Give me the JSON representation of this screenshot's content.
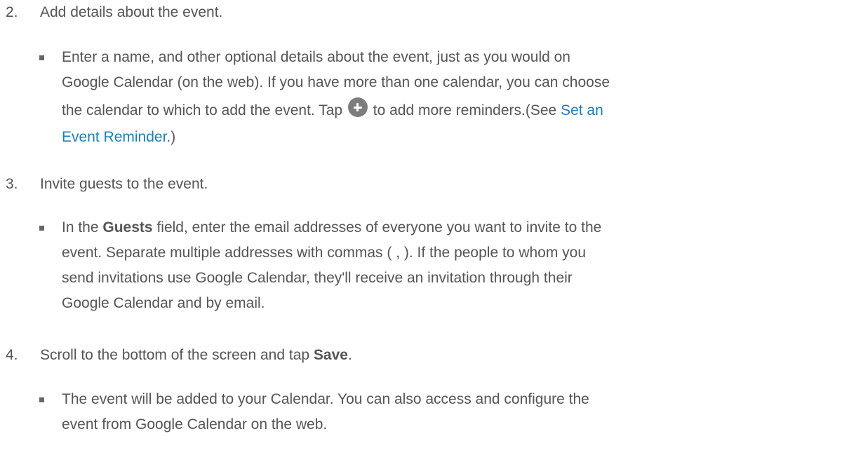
{
  "steps": [
    {
      "number": "2.",
      "text": "Add details about the event.",
      "bullet": {
        "line1": "Enter a name, and other optional details about the event, just as you would on",
        "line2": "Google Calendar (on the web). If you have more than one calendar, you can choose",
        "line3_before_icon": "the calendar to which to add the event. Tap",
        "icon": "plus-circle-icon",
        "line3_after_icon": "to add more reminders.(See",
        "link_part1": "Set an",
        "link_part2": "Event Reminder",
        "line4_after_link": ".)"
      }
    },
    {
      "number": "3.",
      "text": "Invite guests to the event.",
      "bullet": {
        "line1_before_bold": "In the",
        "line1_bold": "Guests",
        "line1_after_bold": "field, enter the email addresses of everyone you want to invite to the",
        "line2": "event. Separate multiple addresses with commas ( , ). If the people to whom you",
        "line3": "send invitations use Google Calendar, they'll receive an invitation through their",
        "line4": "Google Calendar and by email."
      }
    },
    {
      "number": "4.",
      "text_before_bold": "Scroll to the bottom of the screen and tap",
      "text_bold": "Save",
      "text_after_bold": ".",
      "bullet": {
        "line1": "The event will be added to your Calendar. You can also access and configure the",
        "line2": "event from Google Calendar on the web."
      }
    }
  ],
  "colors": {
    "text": "#555555",
    "link": "#1a7fb8",
    "icon_bg": "#7d7d7d"
  }
}
